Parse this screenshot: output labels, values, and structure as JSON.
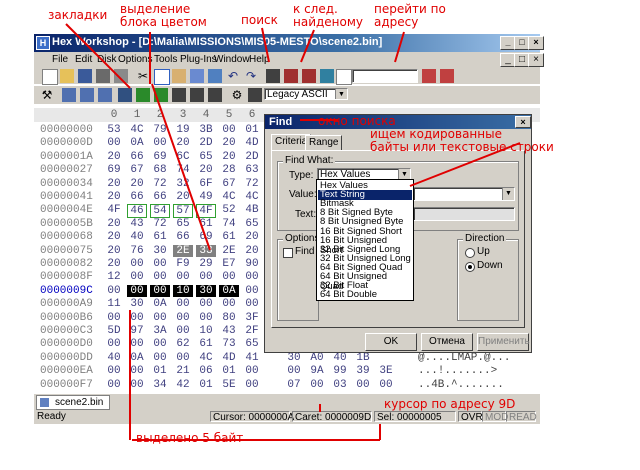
{
  "annotations": {
    "bookmarks": "закладки",
    "highlight": "выделение\nблока цветом",
    "search": "поиск",
    "next_found": "к след.\nнайденому",
    "goto_address": "перейти по\nадресу",
    "search_window": "окно поиска",
    "search_desc": "ищем кодированные\nбайты или текстовые строки",
    "cursor_desc": "курсор по адресу 9D",
    "selected_desc": "выделено 5 байт"
  },
  "window": {
    "title": "Hex Workshop - [D:\\Malia\\MISSIONS\\MIS05-MESTO\\scene2.bin]"
  },
  "menu": [
    "File",
    "Edit",
    "Disk",
    "Options",
    "Tools",
    "Plug-Ins",
    "Window",
    "Help"
  ],
  "toolbar": {
    "charset": "Legacy ASCII",
    "address_value": ""
  },
  "hex": {
    "columns": [
      "0",
      "1",
      "2",
      "3",
      "4",
      "5",
      "6"
    ],
    "rows": [
      {
        "addr": "00000000",
        "bytes": [
          "53",
          "4C",
          "79",
          "19",
          "3B",
          "00",
          "01"
        ],
        "ascii": ""
      },
      {
        "addr": "0000000D",
        "bytes": [
          "00",
          "0A",
          "00",
          "20",
          "2D",
          "20",
          "4D"
        ],
        "ascii": ""
      },
      {
        "addr": "0000001A",
        "bytes": [
          "20",
          "66",
          "69",
          "6C",
          "65",
          "20",
          "2D"
        ],
        "ascii": ""
      },
      {
        "addr": "00000027",
        "bytes": [
          "69",
          "67",
          "68",
          "74",
          "20",
          "28",
          "63"
        ],
        "ascii": ""
      },
      {
        "addr": "00000034",
        "bytes": [
          "20",
          "20",
          "72",
          "32",
          "6F",
          "67",
          "72"
        ],
        "ascii": ""
      },
      {
        "addr": "00000041",
        "bytes": [
          "20",
          "66",
          "66",
          "20",
          "49",
          "4C",
          "4C"
        ],
        "ascii": ""
      },
      {
        "addr": "0000004E",
        "bytes": [
          "4F",
          "46",
          "54",
          "57",
          "4F",
          "52",
          "4B"
        ],
        "ascii": ""
      },
      {
        "addr": "0000005B",
        "bytes": [
          "20",
          "43",
          "72",
          "65",
          "61",
          "74",
          "65"
        ],
        "ascii": ""
      },
      {
        "addr": "00000068",
        "bytes": [
          "20",
          "40",
          "61",
          "66",
          "69",
          "61",
          "20"
        ],
        "ascii": ""
      },
      {
        "addr": "00000075",
        "bytes": [
          "20",
          "76",
          "30",
          "2E",
          "33",
          "2E",
          "20"
        ],
        "ascii": ""
      },
      {
        "addr": "00000082",
        "bytes": [
          "20",
          "00",
          "00",
          "F9",
          "29",
          "E7",
          "90"
        ],
        "ascii": ""
      },
      {
        "addr": "0000008F",
        "bytes": [
          "12",
          "00",
          "00",
          "00",
          "00",
          "00",
          "00"
        ],
        "ascii": ""
      },
      {
        "addr": "0000009C",
        "bytes": [
          "00",
          "00",
          "00",
          "10",
          "30",
          "0A",
          "00"
        ],
        "ascii": ""
      },
      {
        "addr": "000000A9",
        "bytes": [
          "11",
          "30",
          "0A",
          "00",
          "00",
          "00",
          "00"
        ],
        "ascii": ""
      },
      {
        "addr": "000000B6",
        "bytes": [
          "00",
          "00",
          "00",
          "00",
          "00",
          "80",
          "3F"
        ],
        "ascii": ""
      },
      {
        "addr": "000000C3",
        "bytes": [
          "5D",
          "97",
          "3A",
          "00",
          "10",
          "43",
          "2F"
        ],
        "ascii": ""
      },
      {
        "addr": "000000D0",
        "bytes": [
          "00",
          "00",
          "00",
          "62",
          "61",
          "73",
          "65"
        ],
        "ascii": ""
      },
      {
        "addr": "000000DD",
        "bytes": [
          "40",
          "0A",
          "00",
          "00",
          "4C",
          "4D",
          "41"
        ],
        "ascii": "@....LMAP.@..."
      },
      {
        "addr": "000000EA",
        "bytes": [
          "00",
          "00",
          "01",
          "21",
          "06",
          "01",
          "00"
        ],
        "ascii": "...!.......>"
      },
      {
        "addr": "000000F7",
        "bytes": [
          "00",
          "00",
          "34",
          "42",
          "01",
          "5E",
          "00"
        ],
        "ascii": "..4B.^......."
      }
    ],
    "partial_right": [
      [
        "",
        "",
        "",
        ""
      ],
      [
        "",
        "",
        "",
        ""
      ],
      [
        "",
        "",
        "",
        ""
      ],
      [
        "",
        "",
        "",
        ""
      ],
      [
        "",
        "",
        "",
        ""
      ],
      [
        "",
        "",
        "",
        ""
      ],
      [
        "",
        "",
        "",
        ""
      ],
      [
        "",
        "",
        "",
        ""
      ],
      [
        "",
        "",
        "",
        ""
      ],
      [
        "",
        "",
        "",
        ""
      ],
      [
        "",
        "",
        "",
        ""
      ],
      [
        "",
        "",
        "",
        ""
      ],
      [
        "",
        "",
        "",
        ""
      ],
      [
        "",
        "",
        "",
        ""
      ],
      [
        "",
        "",
        "",
        ""
      ],
      [
        "",
        "",
        "",
        ""
      ],
      [
        "",
        "",
        "",
        ""
      ],
      [
        "30",
        "A0",
        "40",
        "1B"
      ],
      [
        "00",
        "9A",
        "99",
        "39",
        "3E"
      ],
      [
        "07",
        "00",
        "03",
        "00",
        "00"
      ]
    ]
  },
  "find_dialog": {
    "title": "Find",
    "tabs": [
      "Criteria",
      "Range"
    ],
    "find_what_label": "Find What:",
    "type_label": "Type:",
    "type_value": "Hex Values",
    "value_label": "Value:",
    "text_label": "Text:",
    "options_label": "Options",
    "find_all_label": "Find",
    "direction_label": "Direction",
    "direction_up": "Up",
    "direction_down": "Down",
    "ok": "OK",
    "cancel": "Отмена",
    "apply": "Применить",
    "type_options": [
      "Hex Values",
      "Text String",
      "Bitmask",
      "8 Bit Signed Byte",
      "8 Bit Unsigned Byte",
      "16 Bit Signed Short",
      "16 Bit Unsigned Short",
      "32 Bit Signed Long",
      "32 Bit Unsigned Long",
      "64 Bit Signed Quad",
      "64 Bit Unsigned Quad",
      "32 Bit Float",
      "64 Bit Double"
    ],
    "selected_option": "Text String"
  },
  "doc_tab": "scene2.bin",
  "status": {
    "ready": "Ready",
    "cursor": "Cursor: 0000000A",
    "caret": "Caret: 0000009D",
    "sel": "Sel: 00000005",
    "ovr": "OVR",
    "mod": "MOD",
    "read": "READ"
  },
  "colors": {
    "accent": "#e00000",
    "title_blue": "#0a246a",
    "selection": "#000000"
  }
}
